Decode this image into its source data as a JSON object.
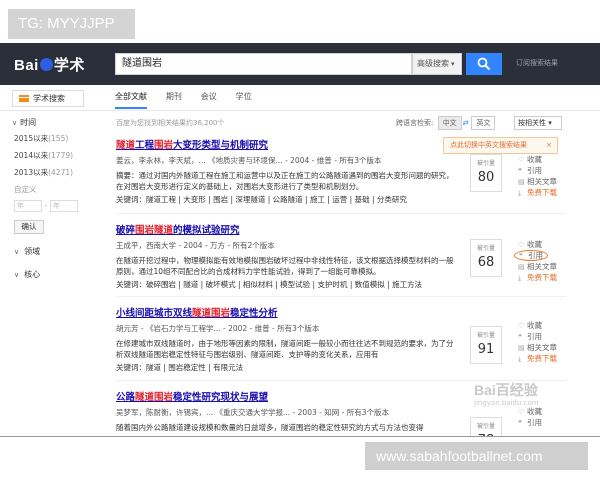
{
  "watermark": {
    "tag": "TG: MYYJJPP",
    "site": "www.sabahfootballnet.com",
    "baidu_logo": "Bai百经验",
    "baidu_url": "jingyan.baidu.com"
  },
  "header": {
    "logo": [
      "Bai",
      "学术"
    ],
    "query": "隧道围岩",
    "advanced": "高级搜索",
    "subscribe": "订阅搜索结果"
  },
  "nav": {
    "menu_label": "学术搜索",
    "tabs": [
      "全部文献",
      "期刊",
      "会议",
      "学位"
    ]
  },
  "toolbar": {
    "results_info": "百度为您找到相关结果约36,200个",
    "lang_label": "跨语言检索:",
    "lang_options": [
      "中文",
      "英文"
    ],
    "sort_label": "按相关性"
  },
  "popup": {
    "text": "点此切换中英文搜索结果"
  },
  "sidebar": {
    "time_label": "时间",
    "years": [
      {
        "label": "2015以来",
        "count": "(155)"
      },
      {
        "label": "2014以来",
        "count": "(1779)"
      },
      {
        "label": "2013以来",
        "count": "(4271)"
      }
    ],
    "custom": "自定义",
    "year_from": "年",
    "year_to": "年",
    "confirm": "确认",
    "field_label": "领域",
    "core_label": "核心"
  },
  "results": [
    {
      "title_pre": "",
      "title_hl": "隧道",
      "title_mid": "工程",
      "title_hl2": "围岩",
      "title_post": "大变形类型与机制研究",
      "meta": "姜云，李永林，李天斌，... 《地质灾害与环境保... - 2004 - 维普 - 所有3个版本",
      "abstract": "摘要：通过对国内外隧道工程在施工和运营中以及正在施工的公路隧道遇到的围岩大变形问题的研究，在对围岩大变形进行定义的基础上，对围岩大变形进行了类型和机制划分。",
      "keywords": "关键词：隧道工程 | 大变形 | 围岩 | 深埋隧道 | 公路隧道 | 施工 | 运营 | 基础 | 分类研究",
      "cite_label": "被引量",
      "cite": "80",
      "actions": [
        "收藏",
        "引用",
        "相关文章",
        "免费下载"
      ]
    },
    {
      "title_pre": "破碎",
      "title_hl": "围岩",
      "title_mid": "",
      "title_hl2": "隧道",
      "title_post": "的模拟试验研究",
      "meta": "王成平，西南大学 - 2004 - 万方 - 所有2个版本",
      "abstract": "在隧道开挖过程中，物理模拟能有效地模拟围岩破坏过程中非线性特征，该文根据选择模型材料的一般原则，通过10组不同配合比的合成材料力学性能试验，得到了一组能可靠模拟。",
      "keywords": "关键词：破碎围岩 | 隧道 | 破坏模式 | 相似材料 | 模型试验 | 支护时机 | 数值模拟 | 施工方法",
      "cite_label": "被引量",
      "cite": "68",
      "actions": [
        "收藏",
        "引用",
        "相关文章",
        "免费下载"
      ]
    },
    {
      "title_pre": "小线间距城市双线",
      "title_hl": "隧道",
      "title_mid": "",
      "title_hl2": "围岩",
      "title_post": "稳定性分析",
      "meta": "胡元芳 - 《岩石力学与工程学... - 2002 - 维普 - 所有3个版本",
      "abstract": "在修建城市双线隧道时，由于地形等因素的限制，隧道间距一般较小而往往达不到规范的要求，为了分析双线隧道围岩稳定性特征与围岩级别、隧道间距、支护等的变化关系，应用有",
      "keywords": "关键词：隧道 | 围岩稳定性 | 有限元法",
      "cite_label": "被引量",
      "cite": "91",
      "actions": [
        "收藏",
        "引用",
        "相关文章",
        "免费下载"
      ]
    },
    {
      "title_pre": "公路",
      "title_hl": "隧道",
      "title_mid": "",
      "title_hl2": "围岩",
      "title_post": "稳定性研究现状与展望",
      "meta": "吴梦军，陈耐衡，许锡宾，... 《重庆交通大学学报... - 2003 - 知网 - 所有3个版本",
      "abstract": "随着国内外公路隧道建设规模和数量的日益增多，隧道围岩的稳定性研究的方式与方法也变得",
      "keywords": "",
      "cite_label": "被引量",
      "cite": "78",
      "actions": [
        "收藏",
        "引用",
        "相关文章",
        "免费下载"
      ]
    }
  ]
}
